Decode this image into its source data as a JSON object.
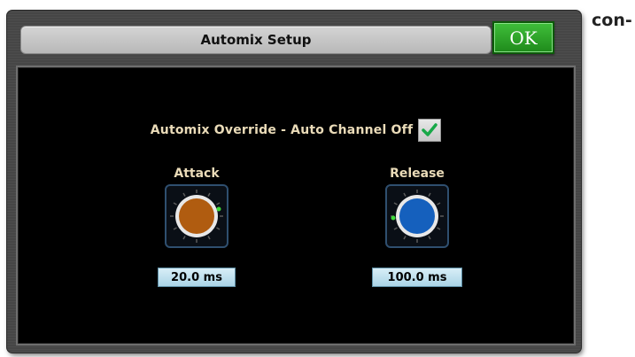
{
  "dialog": {
    "title": "Automix Setup",
    "ok_label": "OK"
  },
  "override": {
    "label": "Automix Override - Auto Channel Off",
    "checked": true
  },
  "attack": {
    "label": "Attack",
    "value": "20.0 ms",
    "knob_color": "#b05c10"
  },
  "release": {
    "label": "Release",
    "value": "100.0 ms",
    "knob_color": "#1560bd"
  },
  "side_text": "con-",
  "colors": {
    "ok_green": "#2ca428",
    "label_cream": "#eadbb8",
    "indicator_green": "#3ddc3a"
  }
}
